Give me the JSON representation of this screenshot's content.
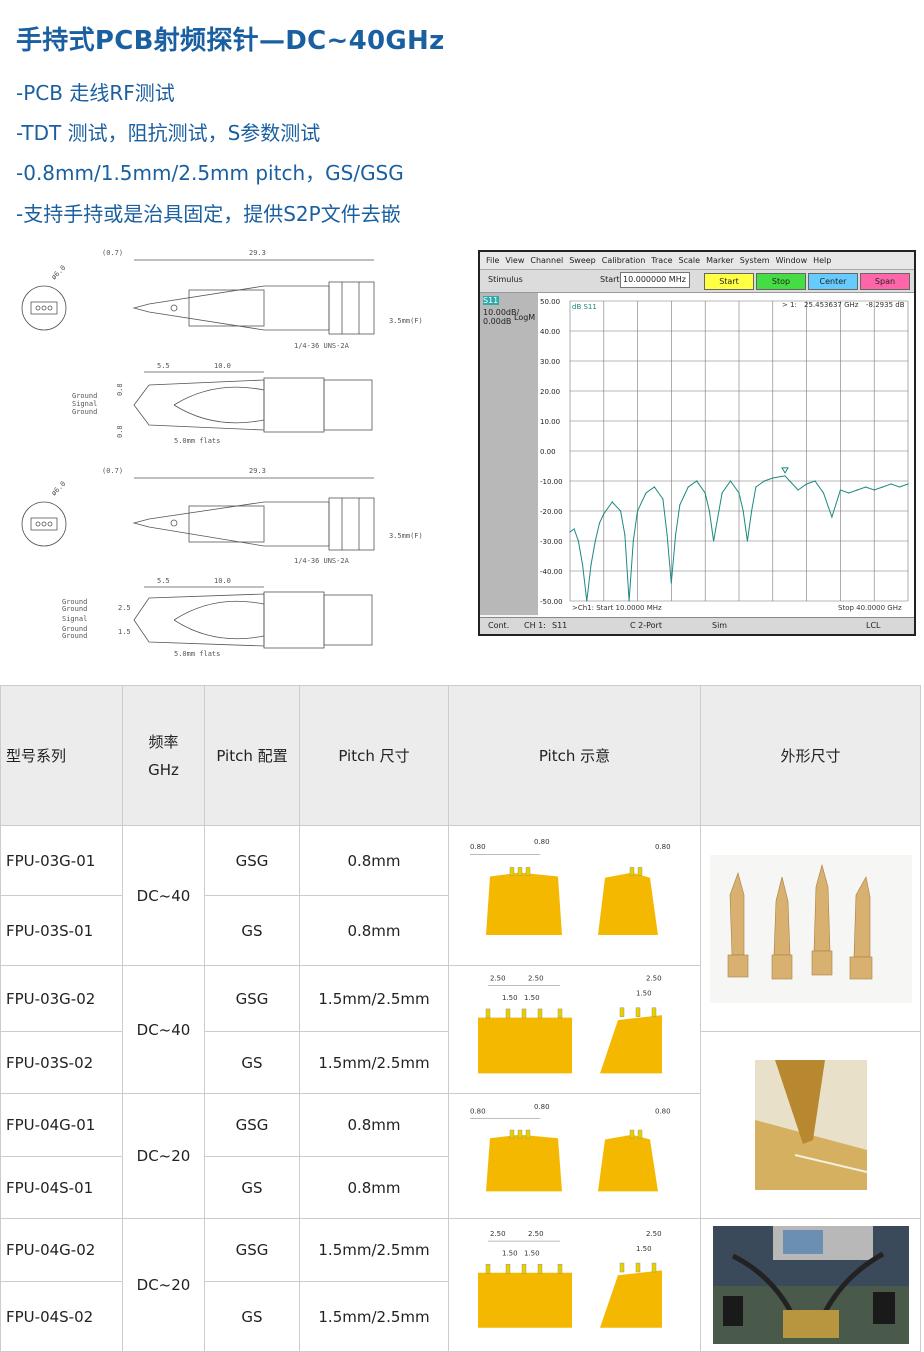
{
  "title": "手持式PCB射频探针—DC~40GHz",
  "bullets": [
    "-PCB 走线RF测试",
    "-TDT 测试，阻抗测试，S参数测试",
    "-0.8mm/1.5mm/2.5mm pitch，GS/GSG",
    "-支持手持或是治具固定，提供S2P文件去嵌"
  ],
  "drawing": {
    "dim_top": "(0.7)",
    "dim_length": "29.3",
    "dim_dia": "ø6.0",
    "connector": "3.5mm(F)",
    "thread": "1/4-36 UNS-2A",
    "dim_a": "5.5",
    "dim_b": "10.0",
    "dim_pitch": "0.8",
    "dim_p1": "2.5",
    "dim_p2": "1.5",
    "ground": "Ground",
    "signal": "Signal",
    "flats": "5.0mm flats"
  },
  "vna": {
    "menu": [
      "File",
      "View",
      "Channel",
      "Sweep",
      "Calibration",
      "Trace",
      "Scale",
      "Marker",
      "System",
      "Window",
      "Help"
    ],
    "stimulus": "Stimulus",
    "start_label": "Start",
    "start_value": "10.000000 MHz",
    "buttons": [
      "Start",
      "Stop",
      "Center",
      "Span"
    ],
    "trace_name": "S11",
    "scale": "10.00dB/",
    "ref": "0.00dB",
    "format": "LogM",
    "marker_label": "> 1:",
    "marker_freq": "25.453637 GHz",
    "marker_val": "-8.2935 dB",
    "trace_tag": "dB S11",
    "y_ticks": [
      "50.00",
      "40.00",
      "30.00",
      "20.00",
      "10.00",
      "0.00",
      "-10.00",
      "-20.00",
      "-30.00",
      "-40.00",
      "-50.00"
    ],
    "start_footer": ">Ch1: Start  10.0000 MHz",
    "stop_footer": "Stop  40.0000 GHz",
    "status": [
      "Cont.",
      "CH 1:",
      "S11",
      "C  2-Port",
      "Sim",
      "LCL"
    ]
  },
  "chart_data": {
    "type": "line",
    "title": "",
    "xlabel": "",
    "ylabel": "",
    "x_unit": "GHz",
    "xlim": [
      0.01,
      40
    ],
    "ylim": [
      -50,
      50
    ],
    "grid": true,
    "series": [
      {
        "name": "S11",
        "x": [
          0.01,
          0.5,
          1,
          1.5,
          2,
          2.5,
          3,
          3.5,
          4,
          5,
          6,
          6.5,
          7,
          7.5,
          8,
          9,
          10,
          11,
          11.5,
          12,
          12.5,
          13,
          14,
          15,
          16,
          16.5,
          17,
          18,
          19,
          20,
          20.5,
          21,
          21.5,
          22,
          23,
          24,
          25,
          25.45,
          26,
          27,
          28,
          29,
          30,
          31,
          32,
          33,
          34,
          35,
          36,
          37,
          38,
          39,
          40
        ],
        "y": [
          -27,
          -26,
          -30,
          -38,
          -50,
          -38,
          -30,
          -24,
          -21,
          -17,
          -20,
          -28,
          -50,
          -30,
          -20,
          -14,
          -12,
          -16,
          -28,
          -44,
          -28,
          -18,
          -12,
          -10,
          -14,
          -20,
          -30,
          -14,
          -10,
          -14,
          -20,
          -30,
          -20,
          -12,
          -10,
          -9,
          -8.5,
          -8.3,
          -10,
          -13,
          -11,
          -10,
          -14,
          -22,
          -13,
          -14,
          -13,
          -12,
          -13,
          -12,
          -11,
          -12,
          -11
        ]
      }
    ]
  },
  "table": {
    "headers": [
      "型号系列",
      "频率 GHz",
      "Pitch 配置",
      "Pitch 尺寸",
      "Pitch 示意",
      "外形尺寸"
    ],
    "rows": [
      {
        "model": "FPU-03G-01",
        "freq": "DC~40",
        "config": "GSG",
        "pitch": "0.8mm"
      },
      {
        "model": "FPU-03S-01",
        "freq": "DC~40",
        "config": "GS",
        "pitch": "0.8mm"
      },
      {
        "model": "FPU-03G-02",
        "freq": "DC~40",
        "config": "GSG",
        "pitch": "1.5mm/2.5mm"
      },
      {
        "model": "FPU-03S-02",
        "freq": "DC~40",
        "config": "GS",
        "pitch": "1.5mm/2.5mm"
      },
      {
        "model": "FPU-04G-01",
        "freq": "DC~20",
        "config": "GSG",
        "pitch": "0.8mm"
      },
      {
        "model": "FPU-04S-01",
        "freq": "DC~20",
        "config": "GS",
        "pitch": "0.8mm"
      },
      {
        "model": "FPU-04G-02",
        "freq": "DC~20",
        "config": "GSG",
        "pitch": "1.5mm/2.5mm"
      },
      {
        "model": "FPU-04S-02",
        "freq": "DC~20",
        "config": "GS",
        "pitch": "1.5mm/2.5mm"
      }
    ],
    "pitch_labels": {
      "fine": "0.80",
      "wide": "2.50",
      "narrow": "1.50"
    }
  },
  "colors": {
    "title": "#1a5fa0",
    "probe": "#f5b800",
    "trace": "#1a8a80",
    "header_bg": "#ececec"
  }
}
